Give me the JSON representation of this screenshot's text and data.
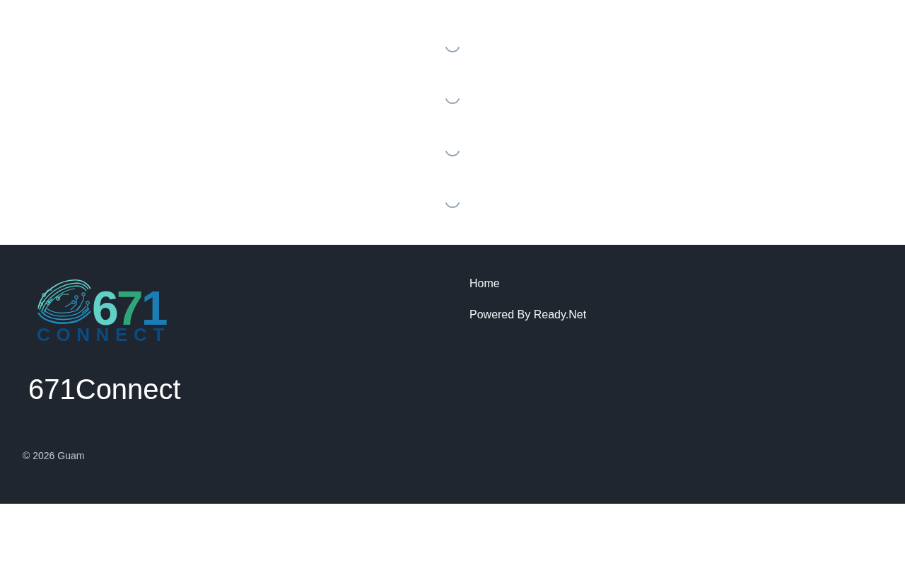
{
  "content": {
    "loaders": [
      {
        "kind": "spinner"
      },
      {
        "kind": "spinner"
      },
      {
        "kind": "spinner"
      },
      {
        "kind": "spinner"
      }
    ]
  },
  "footer": {
    "logo": {
      "number": "671",
      "wordmark": "CONNECT"
    },
    "site_name": "671Connect",
    "links": [
      "Home",
      "Powered By Ready.Net"
    ],
    "copyright": "© 2026 Guam"
  }
}
